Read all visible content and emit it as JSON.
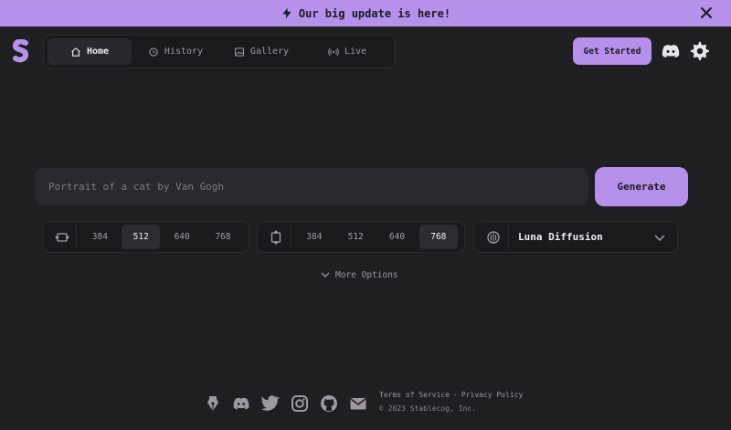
{
  "banner": {
    "text": "Our big update is here!",
    "icon": "bolt-icon",
    "close_icon": "close-icon"
  },
  "colors": {
    "accent": "#b691ec",
    "background": "#1f1e21",
    "surface": "#2a292d"
  },
  "nav": {
    "items": [
      {
        "label": "Home",
        "icon": "home-icon",
        "active": true
      },
      {
        "label": "History",
        "icon": "history-icon",
        "active": false
      },
      {
        "label": "Gallery",
        "icon": "gallery-icon",
        "active": false
      },
      {
        "label": "Live",
        "icon": "live-icon",
        "active": false
      }
    ]
  },
  "header": {
    "get_started_label": "Get Started",
    "discord_icon": "discord-icon",
    "settings_icon": "gear-icon"
  },
  "prompt": {
    "placeholder": "Portrait of a cat by Van Gogh",
    "value": ""
  },
  "generate_label": "Generate",
  "width_options": {
    "icon": "width-icon",
    "values": [
      "384",
      "512",
      "640",
      "768"
    ],
    "selected": "512"
  },
  "height_options": {
    "icon": "height-icon",
    "values": [
      "384",
      "512",
      "640",
      "768"
    ],
    "selected": "768"
  },
  "model": {
    "icon": "brain-icon",
    "selected": "Luna Diffusion"
  },
  "more_options_label": "More Options",
  "footer": {
    "social_icons": [
      "pen-icon",
      "discord-icon",
      "twitter-icon",
      "instagram-icon",
      "github-icon",
      "mail-icon"
    ],
    "terms_label": "Terms of Service",
    "separator": "·",
    "privacy_label": "Privacy Policy",
    "copyright": "© 2023 Stablecog, Inc."
  }
}
